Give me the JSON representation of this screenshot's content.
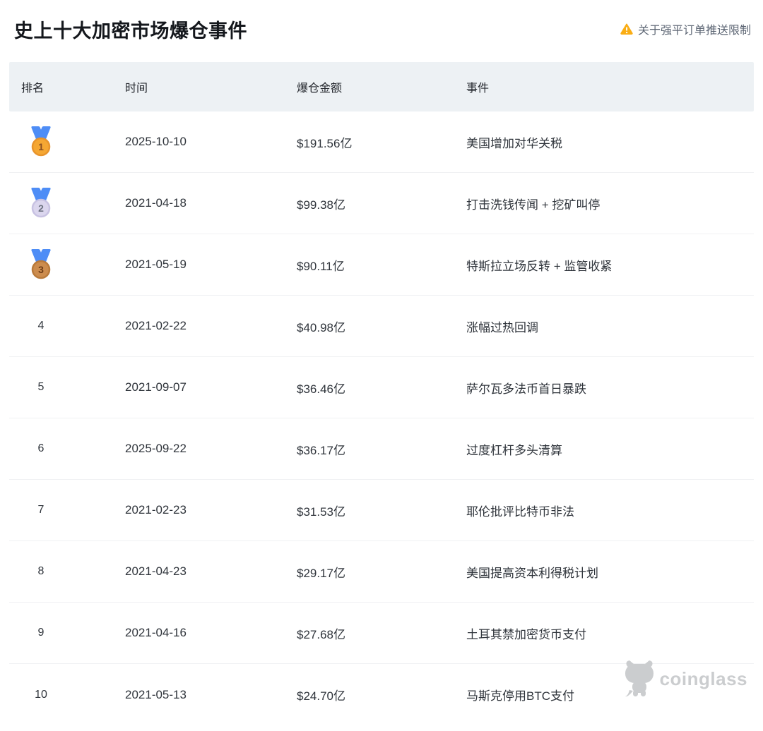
{
  "page": {
    "title": "史上十大加密市场爆仓事件",
    "notice_label": "关于强平订单推送限制"
  },
  "table": {
    "headers": [
      "排名",
      "时间",
      "爆仓金额",
      "事件"
    ],
    "rows": [
      {
        "rank": "1",
        "medal": "gold",
        "date": "2025-10-10",
        "amount": "$191.56亿",
        "event": "美国增加对华关税"
      },
      {
        "rank": "2",
        "medal": "silver",
        "date": "2021-04-18",
        "amount": "$99.38亿",
        "event": "打击洗钱传闻 + 挖矿叫停"
      },
      {
        "rank": "3",
        "medal": "bronze",
        "date": "2021-05-19",
        "amount": "$90.11亿",
        "event": "特斯拉立场反转 + 监管收紧"
      },
      {
        "rank": "4",
        "medal": null,
        "date": "2021-02-22",
        "amount": "$40.98亿",
        "event": "涨幅过热回调"
      },
      {
        "rank": "5",
        "medal": null,
        "date": "2021-09-07",
        "amount": "$36.46亿",
        "event": "萨尔瓦多法币首日暴跌"
      },
      {
        "rank": "6",
        "medal": null,
        "date": "2025-09-22",
        "amount": "$36.17亿",
        "event": "过度杠杆多头清算"
      },
      {
        "rank": "7",
        "medal": null,
        "date": "2021-02-23",
        "amount": "$31.53亿",
        "event": "耶伦批评比特币非法"
      },
      {
        "rank": "8",
        "medal": null,
        "date": "2021-04-23",
        "amount": "$29.17亿",
        "event": "美国提高资本利得税计划"
      },
      {
        "rank": "9",
        "medal": null,
        "date": "2021-04-16",
        "amount": "$27.68亿",
        "event": "土耳其禁加密货币支付"
      },
      {
        "rank": "10",
        "medal": null,
        "date": "2021-05-13",
        "amount": "$24.70亿",
        "event": "马斯克停用BTC支付"
      }
    ]
  },
  "watermark": {
    "brand": "coinglass"
  },
  "colors": {
    "title_text": "#14171c",
    "header_row_bg": "#edf1f4",
    "header_text": "#23262c",
    "body_text": "#2f343b",
    "divider": "#f0f1f3",
    "notice_text": "#5d6674",
    "warning_orange": "#FAAD14",
    "watermark_gray": "#c7c9cb",
    "medals": {
      "gold": {
        "ribbon": "#4E8DF6",
        "circle": "#F5A733",
        "rim": "#E8942C",
        "number": "#8A4F21"
      },
      "silver": {
        "ribbon": "#4E8DF6",
        "circle": "#DBD6EE",
        "rim": "#C8C2E2",
        "number": "#6E7382"
      },
      "bronze": {
        "ribbon": "#4E8DF6",
        "circle": "#CC8C4E",
        "rim": "#B97A3B",
        "number": "#6E3C16"
      }
    }
  }
}
